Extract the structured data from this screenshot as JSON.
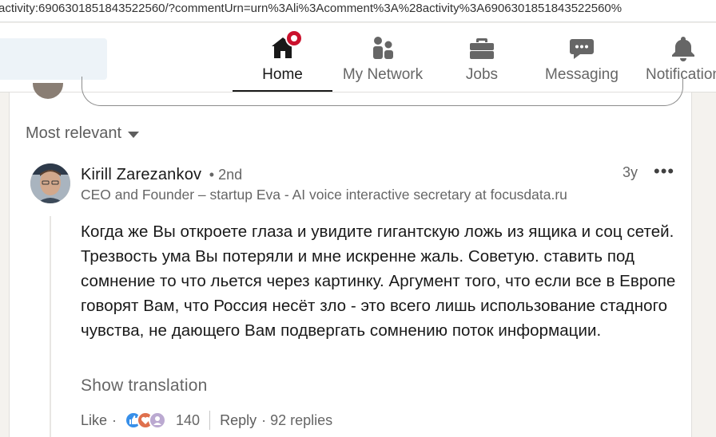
{
  "browser": {
    "url_prefix": "activity:6906301851843522560/?commentUrn=urn%3Ali%3Acomment%3A%28activity%3A6906301851843522560%"
  },
  "nav": {
    "items": [
      {
        "label": "Home",
        "icon": "home-icon",
        "active": true
      },
      {
        "label": "My Network",
        "icon": "network-icon"
      },
      {
        "label": "Jobs",
        "icon": "briefcase-icon"
      },
      {
        "label": "Messaging",
        "icon": "messaging-icon"
      },
      {
        "label": "Notification",
        "icon": "bell-icon"
      }
    ],
    "notification_badge_color": "#cb112d"
  },
  "comments": {
    "sort_label": "Most relevant",
    "comment": {
      "author": "Kirill Zarezankov",
      "degree": "• 2nd",
      "headline": "CEO and Founder – startup Eva - AI voice interactive secretary at focusdata.ru",
      "time": "3y",
      "more": "•••",
      "text": "Когда же Вы откроете глаза и увидите гигантскую ложь из ящика и соц сетей. Трезвость ума Вы потеряли и мне искренне жаль. Советую. ставить под сомнение то что льется через картинку. Аргумент того, что если все в Европе говорят Вам, что Россия несёт зло - это всего лишь использование стадного чувства, не дающего Вам подвергать сомнению поток информации.",
      "show_translation": "Show translation",
      "like_label": "Like",
      "dot": "·",
      "reactions": [
        "like-icon",
        "love-icon",
        "support-icon"
      ],
      "reaction_count": "140",
      "reply_label": "Reply",
      "replies": "· 92 replies"
    }
  }
}
